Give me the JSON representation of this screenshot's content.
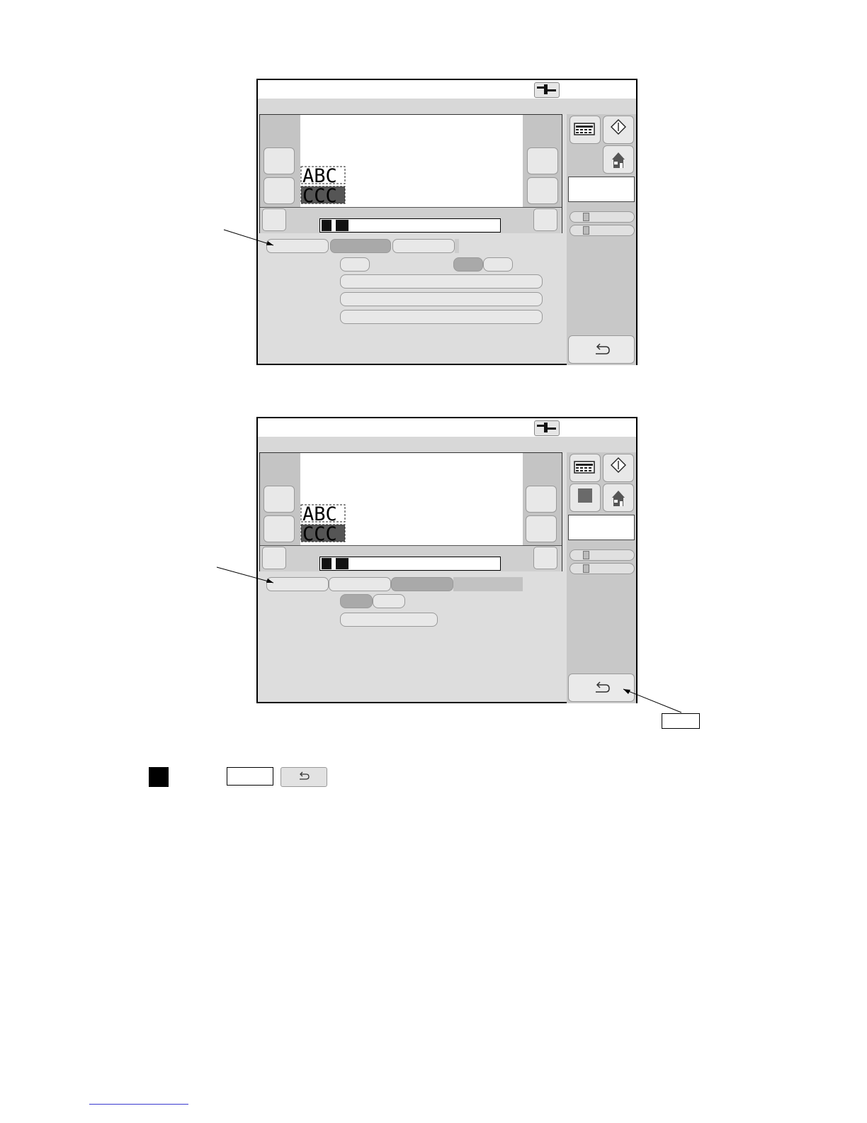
{
  "screens": [
    {
      "name": "screen-top",
      "active_tab": 2,
      "preview_text": "ABC"
    },
    {
      "name": "screen-bottom",
      "active_tab": 3,
      "preview_text": "ABC"
    }
  ],
  "icons": {
    "titlebar": "connector-icon",
    "panel": "keyboard-display-icon",
    "start": "diamond-start-icon",
    "home": "home-icon",
    "stop": "stop-square-icon",
    "back": "return-arrow-icon"
  },
  "glyphs": {
    "back": "⮌"
  },
  "legend": {
    "callout_text": "",
    "box_text": ""
  },
  "colors": {
    "active_tab": "#a9a9a9",
    "screen_bg": "#dddddd",
    "link": "#3a3ad0"
  }
}
